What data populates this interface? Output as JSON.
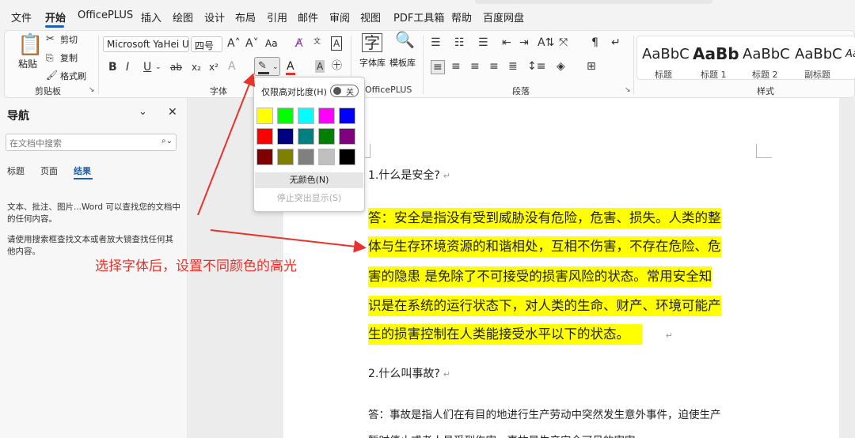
{
  "menubar": {
    "items": [
      {
        "label": "文件"
      },
      {
        "label": "开始"
      },
      {
        "label": "OfficePLUS"
      },
      {
        "label": "插入"
      },
      {
        "label": "绘图"
      },
      {
        "label": "设计"
      },
      {
        "label": "布局"
      },
      {
        "label": "引用"
      },
      {
        "label": "邮件"
      },
      {
        "label": "审阅"
      },
      {
        "label": "视图"
      },
      {
        "label": "PDF工具箱"
      },
      {
        "label": "帮助"
      },
      {
        "label": "百度网盘"
      }
    ],
    "active": "开始"
  },
  "ribbon": {
    "clipboard": {
      "paste": "粘贴",
      "cut": "剪切",
      "copy": "复制",
      "format_painter": "格式刷",
      "group": "剪贴板"
    },
    "font": {
      "font_name": "Microsoft YaHei UI",
      "font_size": "四号",
      "change_case": "Aa",
      "group": "字体"
    },
    "officeplus": {
      "fonts": "字体库",
      "templates": "模板库",
      "group": "OfficePLUS"
    },
    "paragraph": {
      "group": "段落"
    },
    "styles": {
      "group": "样式",
      "items": [
        {
          "sample": "AaBbC",
          "name": "标题"
        },
        {
          "sample": "AaBb",
          "name": "标题 1"
        },
        {
          "sample": "AaBbC",
          "name": "标题 2"
        },
        {
          "sample": "AaBbC",
          "name": "副标题"
        },
        {
          "sample": "AaB",
          "name": ""
        }
      ]
    }
  },
  "nav": {
    "title": "导航",
    "search_placeholder": "在文档中搜索",
    "tabs": [
      {
        "label": "标题"
      },
      {
        "label": "页面"
      },
      {
        "label": "结果"
      }
    ],
    "active_tab": "结果",
    "info1": "文本、批注、图片...Word 可以查找您的文档中的任何内容。",
    "info2": "请使用搜索框查找文本或者放大镜查找任何其他内容。"
  },
  "highlight_popup": {
    "contrast_label": "仅限高对比度(H)",
    "toggle_label": "关",
    "colors": [
      "#ffff00",
      "#00ff00",
      "#00ffff",
      "#ff00ff",
      "#0000ff",
      "#ff0000",
      "#000080",
      "#008080",
      "#008000",
      "#800080",
      "#800000",
      "#808000",
      "#808080",
      "#c0c0c0",
      "#000000"
    ],
    "no_color": "无颜色(N)",
    "stop_highlight": "停止突出显示(S)"
  },
  "document": {
    "q1": "1.什么是安全?",
    "a1_lines": [
      "答：安全是指没有受到威胁没有危险，危害、损失。人类的整",
      "体与生存环境资源的和谐相处，互相不伤害，不存在危险、危",
      "害的隐患  是免除了不可接受的损害风险的状态。常用安全知",
      "识是在系统的运行状态下，对人类的生命、财产、环境可能产",
      "生的损害控制在人类能接受水平以下的状态。"
    ],
    "q2": "2.什么叫事故?",
    "a2_line1": "答：事故是指人们在有目的地进行生产劳动中突然发生意外事件，迫使生产",
    "a2_line2": "暂时停止或者人员受到伤害，事故是生产安全可见的害害"
  },
  "annotation": {
    "text": "选择字体后，设置不同颜色的高光",
    "color": "#e8322b"
  }
}
